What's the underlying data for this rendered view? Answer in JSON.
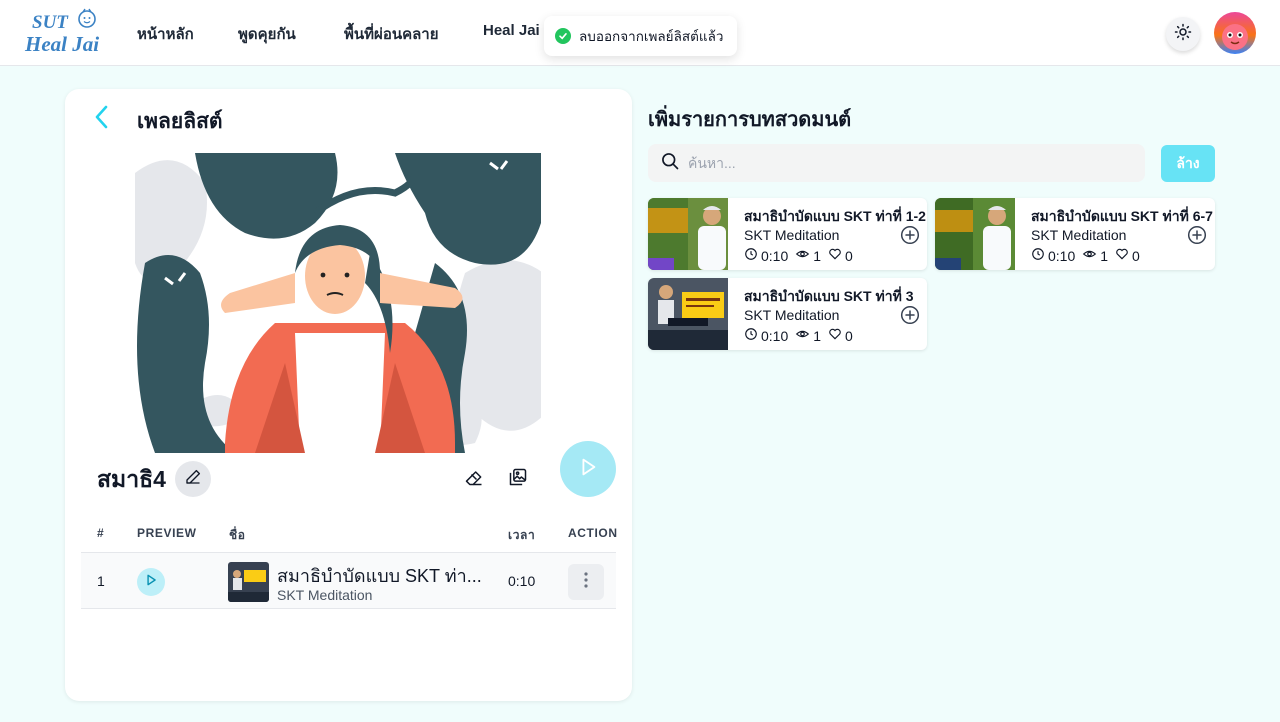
{
  "header": {
    "logo_line1": "SUT",
    "logo_line2": "Heal Jai",
    "nav": [
      {
        "label": "หน้าหลัก"
      },
      {
        "label": "พูดคุยกัน"
      },
      {
        "label": "พื้นที่ผ่อนคลาย"
      },
      {
        "label": "Heal Jai C"
      }
    ]
  },
  "toast": {
    "message": "ลบออกจากเพลย์ลิสต์แล้ว"
  },
  "playlist": {
    "header_title": "เพลยลิสต์",
    "name": "สมาธิ4",
    "columns": {
      "index": "#",
      "preview": "PREVIEW",
      "name": "ชื่อ",
      "time": "เวลา",
      "action": "ACTION"
    },
    "rows": [
      {
        "index": "1",
        "title": "สมาธิบำบัดแบบ SKT ท่า...",
        "subtitle": "SKT Meditation",
        "time": "0:10"
      }
    ]
  },
  "add_panel": {
    "title": "เพิ่มรายการบทสวดมนต์",
    "search_placeholder": "ค้นหา...",
    "clear_label": "ล้าง",
    "cards": [
      {
        "title": "สมาธิบำบัดแบบ SKT ท่าที่ 1-2",
        "subtitle": "SKT Meditation",
        "duration": "0:10",
        "views": "1",
        "likes": "0"
      },
      {
        "title": "สมาธิบำบัดแบบ SKT ท่าที่ 6-7",
        "subtitle": "SKT Meditation",
        "duration": "0:10",
        "views": "1",
        "likes": "0"
      },
      {
        "title": "สมาธิบำบัดแบบ SKT ท่าที่ 3",
        "subtitle": "SKT Meditation",
        "duration": "0:10",
        "views": "1",
        "likes": "0"
      }
    ]
  },
  "colors": {
    "accent": "#22d3ee",
    "accent_light": "#a5e9f5",
    "logo_blue": "#3b82c4",
    "background": "#f0fdfc"
  }
}
